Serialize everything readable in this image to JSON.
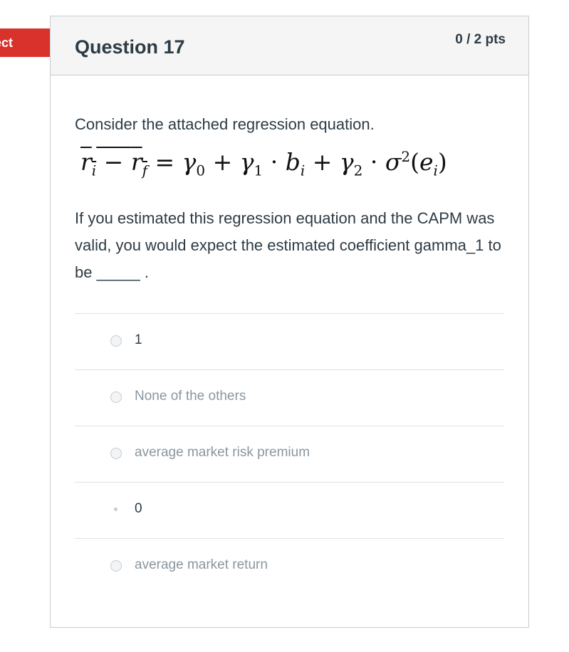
{
  "flag": {
    "label": "Incorrect",
    "visible_label": "ect"
  },
  "question": {
    "title": "Question 17",
    "points": "0 / 2 pts",
    "intro": "Consider the attached regression equation.",
    "equation": {
      "lhs": "r_i − r_f",
      "rhs": "= γ0 + γ1 · b_i + γ2 · σ²(e_i)"
    },
    "text": "If you estimated this regression equation and the CAPM was valid, you would expect the estimated coefficient gamma_1 to be _____ ."
  },
  "answers": [
    {
      "label": "1",
      "selected": false
    },
    {
      "label": "None of the others",
      "selected": false
    },
    {
      "label": "average market risk premium",
      "selected": false
    },
    {
      "label": "0",
      "selected": true
    },
    {
      "label": "average market return",
      "selected": false
    }
  ],
  "colors": {
    "incorrect_flag": "#d9312b",
    "header_bg": "#f5f5f5",
    "border": "#c7cdd1",
    "text": "#2d3b45",
    "muted_text": "#8b969e"
  }
}
